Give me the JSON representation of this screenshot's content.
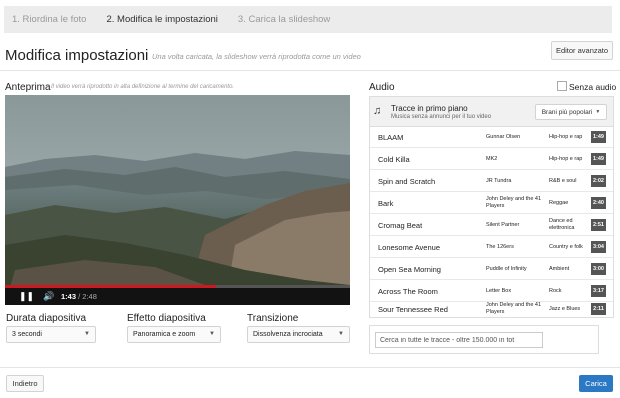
{
  "steps": [
    {
      "label": "1. Riordina le foto",
      "active": false
    },
    {
      "label": "2. Modifica le impostazioni",
      "active": true
    },
    {
      "label": "3. Carica la slideshow",
      "active": false
    }
  ],
  "header": {
    "title": "Modifica impostazioni",
    "subtitle": "Una volta caricata, la slideshow verrà riprodotta come un video",
    "advanced_button": "Editor avanzato"
  },
  "preview": {
    "label": "Anteprima",
    "note": "Il video verrà riprodotto in alta definizione al termine del caricamento.",
    "current_time": "1:43",
    "separator": " / ",
    "duration": "2:48",
    "progress": 0.613,
    "pause_icon": "pause-icon",
    "volume_icon": "volume-icon"
  },
  "settings": {
    "duration": {
      "label": "Durata diapositiva",
      "value": "3 secondi"
    },
    "effect": {
      "label": "Effetto diapositiva",
      "value": "Panoramica e zoom"
    },
    "transition": {
      "label": "Transizione",
      "value": "Dissolvenza incrociata"
    }
  },
  "audio": {
    "label": "Audio",
    "no_audio_label": "Senza audio",
    "no_audio_checked": false,
    "header_title": "Tracce in primo piano",
    "header_subtitle": "Musica senza annunci per il tuo video",
    "filter_value": "Brani più popolari",
    "tracks": [
      {
        "title": "BLAAM",
        "artist": "Gunnar Olsen",
        "genre": "Hip-hop e rap",
        "duration": "1:49"
      },
      {
        "title": "Cold Killa",
        "artist": "MK2",
        "genre": "Hip-hop e rap",
        "duration": "1:49"
      },
      {
        "title": "Spin and Scratch",
        "artist": "JR Tundra",
        "genre": "R&B e soul",
        "duration": "2:02"
      },
      {
        "title": "Bark",
        "artist": "John Deley and the 41 Players",
        "genre": "Reggae",
        "duration": "2:40"
      },
      {
        "title": "Cromag Beat",
        "artist": "Silent Partner",
        "genre": "Dance ed elettronica",
        "duration": "2:51"
      },
      {
        "title": "Lonesome Avenue",
        "artist": "The 126ers",
        "genre": "Country e folk",
        "duration": "3:04"
      },
      {
        "title": "Open Sea Morning",
        "artist": "Puddle of Infinity",
        "genre": "Ambient",
        "duration": "3:00"
      },
      {
        "title": "Across The Room",
        "artist": "Letter Box",
        "genre": "Rock",
        "duration": "3:17"
      },
      {
        "title": "Sour Tennessee Red",
        "artist": "John Deley and the 41 Players",
        "genre": "Jazz e Blues",
        "duration": "2:11"
      }
    ],
    "search_placeholder": "Cerca in tutte le tracce - oltre 150.000 in tot"
  },
  "footer": {
    "back_button": "Indietro",
    "upload_button": "Carica"
  },
  "colors": {
    "primary_button": "#2b78c5",
    "progress_red": "#cc181e"
  }
}
